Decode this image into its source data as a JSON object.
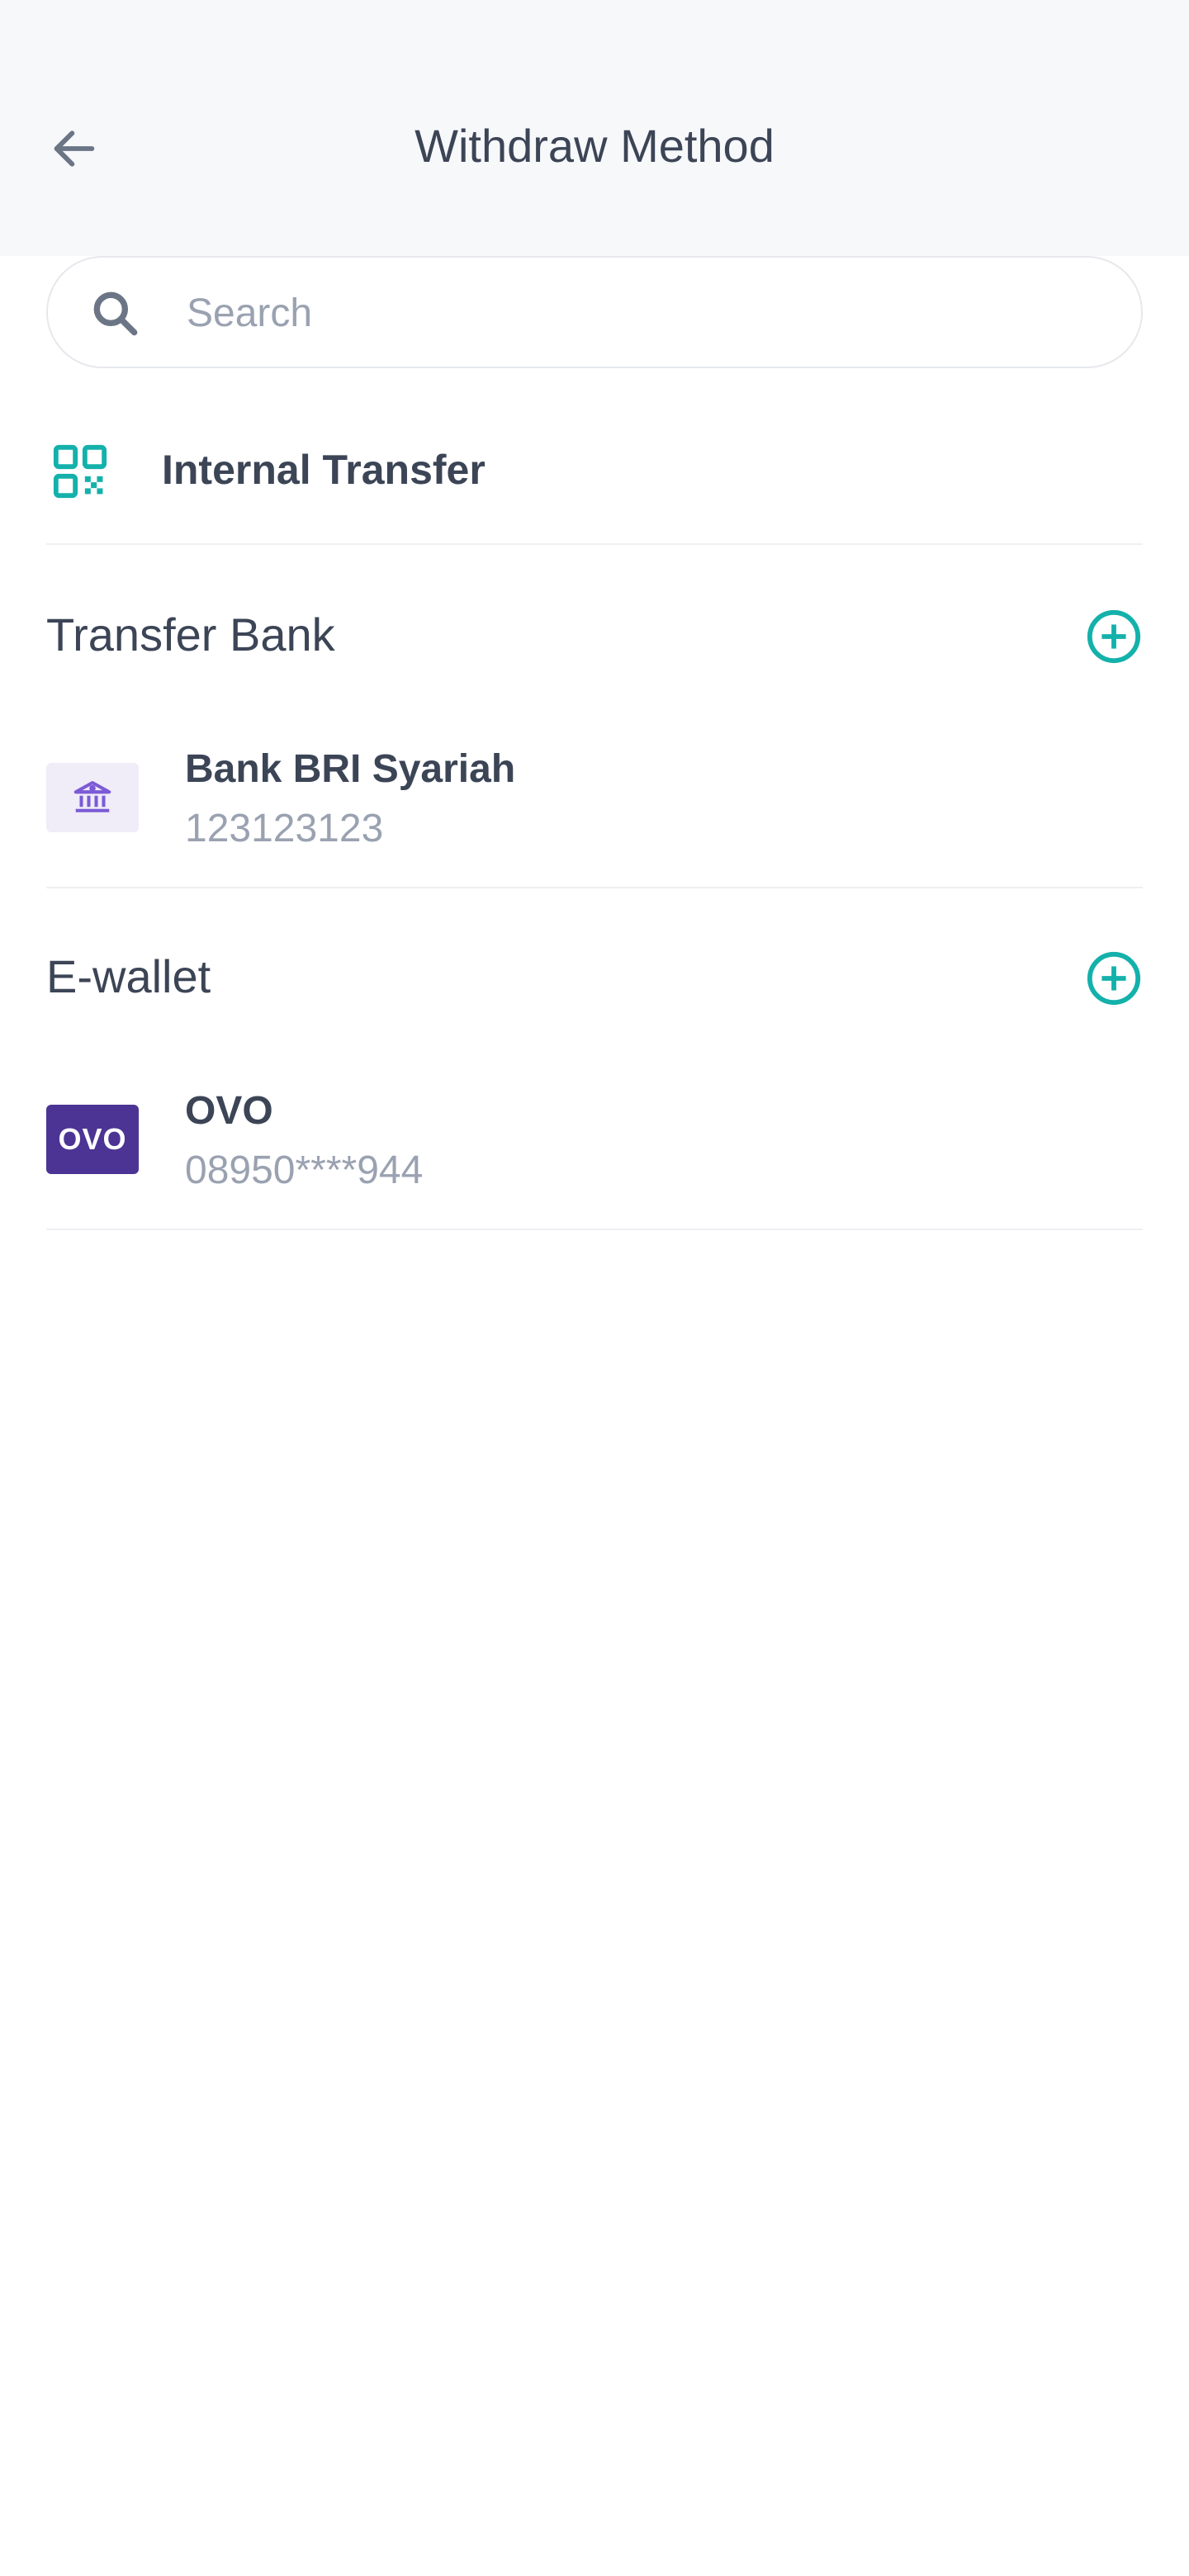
{
  "header": {
    "title": "Withdraw Method",
    "back_icon": "arrow-left-icon"
  },
  "search": {
    "placeholder": "Search",
    "value": "",
    "icon": "search-icon"
  },
  "internal_transfer": {
    "label": "Internal Transfer",
    "icon": "qr-code-icon"
  },
  "sections": {
    "bank": {
      "title": "Transfer Bank",
      "add_icon": "plus-circle-icon",
      "items": [
        {
          "name": "Bank BRI Syariah",
          "number": "123123123",
          "icon": "bank-icon"
        }
      ]
    },
    "ewallet": {
      "title": "E-wallet",
      "add_icon": "plus-circle-icon",
      "items": [
        {
          "name": "OVO",
          "number": "08950****944",
          "logo_text": "OVO"
        }
      ]
    }
  },
  "colors": {
    "accent": "#14b1ab",
    "text": "#3c4556",
    "muted": "#9aa2b1",
    "ovo": "#4c3494",
    "bank_icon": "#7b5bd6"
  }
}
